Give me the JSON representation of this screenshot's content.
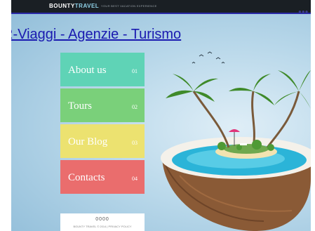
{
  "header": {
    "logo_bold": "BOUNTY",
    "logo_light": "TRAVEL",
    "tagline": "YOUR BEST VACATION EXPERIENCE"
  },
  "page_link": {
    "text": "R-Viaggi - Agenzie - Turismo"
  },
  "menu": {
    "items": [
      {
        "label": "About us",
        "num": "01",
        "color": "#5fd3b6"
      },
      {
        "label": "Tours",
        "num": "02",
        "color": "#7ad07a"
      },
      {
        "label": "Our Blog",
        "num": "03",
        "color": "#ece270"
      },
      {
        "label": "Contacts",
        "num": "04",
        "color": "#ea6d6d"
      }
    ]
  },
  "card": {
    "dots": "0000",
    "small": "BOUNTY TRAVEL © 2014 | PRIVACY POLICY"
  },
  "colors": {
    "topbar": "#1a1f24",
    "link": "#1a1ab0",
    "sky": "#b9d8ea"
  }
}
